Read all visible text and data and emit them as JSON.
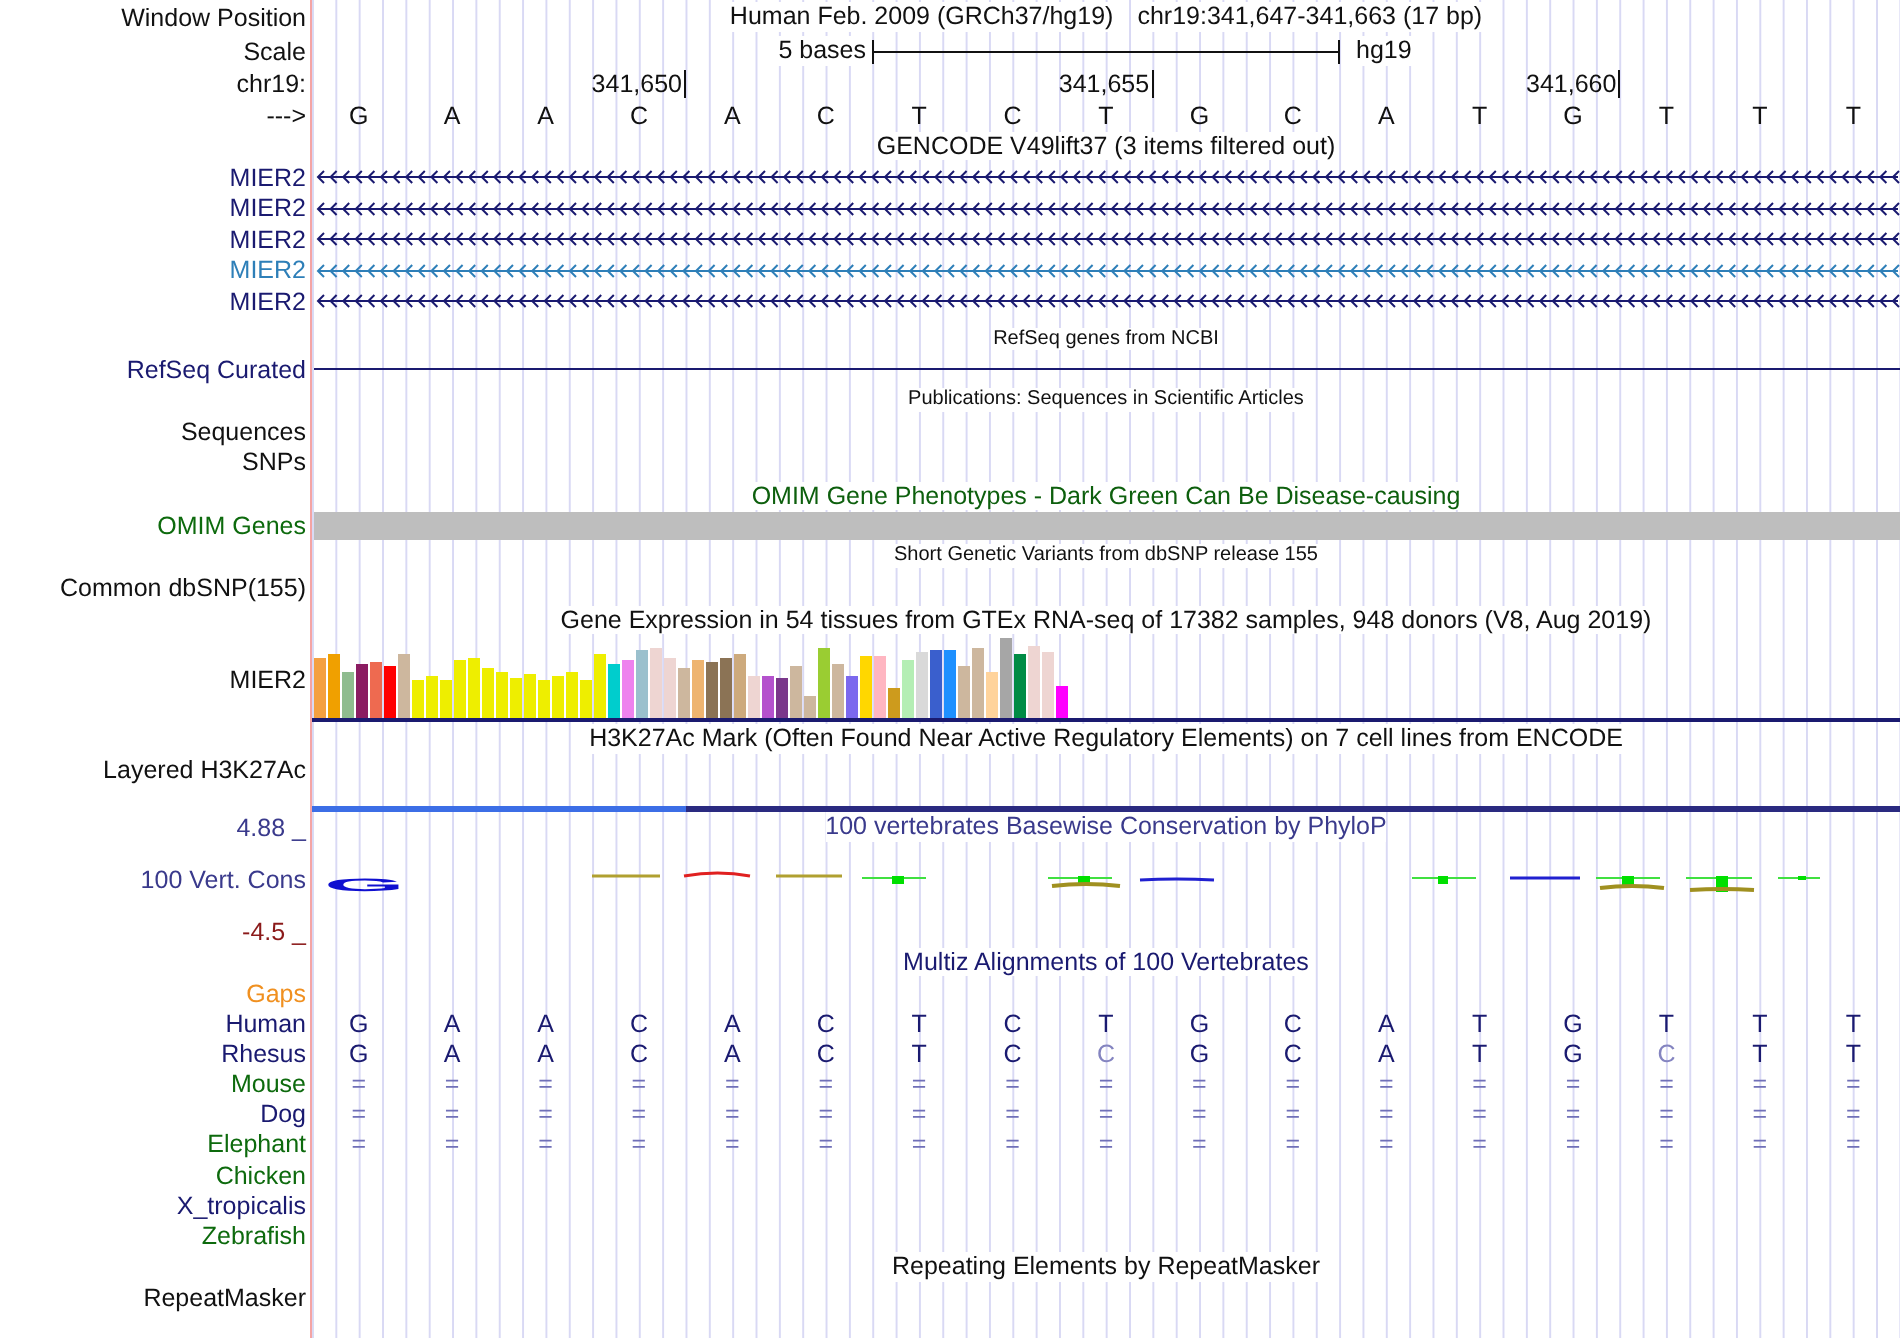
{
  "header": {
    "window_position_label": "Window Position",
    "assembly": "Human Feb. 2009 (GRCh37/hg19)",
    "position": "chr19:341,647-341,663 (17 bp)",
    "scale_label": "Scale",
    "scale_text": "5 bases",
    "scale_db": "hg19",
    "chrom_label": "chr19:",
    "strand_label": "--->"
  },
  "bases": [
    {
      "letter": "G"
    },
    {
      "letter": "A"
    },
    {
      "letter": "A"
    },
    {
      "letter": "C",
      "tick": "341,650"
    },
    {
      "letter": "A"
    },
    {
      "letter": "C"
    },
    {
      "letter": "T"
    },
    {
      "letter": "C"
    },
    {
      "letter": "T",
      "tick": "341,655"
    },
    {
      "letter": "G"
    },
    {
      "letter": "C"
    },
    {
      "letter": "A"
    },
    {
      "letter": "T"
    },
    {
      "letter": "G",
      "tick": "341,660"
    },
    {
      "letter": "T"
    },
    {
      "letter": "T"
    },
    {
      "letter": "T"
    }
  ],
  "gencode": {
    "title": "GENCODE V49lift37 (3 items filtered out)",
    "genes": [
      {
        "name": "MIER2",
        "color": "#1a1a70"
      },
      {
        "name": "MIER2",
        "color": "#1a1a70"
      },
      {
        "name": "MIER2",
        "color": "#1a1a70"
      },
      {
        "name": "MIER2",
        "color": "#2e7fb8"
      },
      {
        "name": "MIER2",
        "color": "#1a1a70"
      }
    ]
  },
  "refseq": {
    "title": "RefSeq genes from NCBI",
    "label": "RefSeq Curated"
  },
  "publications": {
    "title": "Publications: Sequences in Scientific Articles",
    "labels": [
      "Sequences",
      "SNPs"
    ]
  },
  "omim": {
    "title": "OMIM Gene Phenotypes - Dark Green Can Be Disease-causing",
    "label": "OMIM Genes"
  },
  "dbsnp": {
    "title": "Short Genetic Variants from dbSNP release 155",
    "label": "Common dbSNP(155)"
  },
  "gtex": {
    "title": "Gene Expression in 54 tissues from GTEx RNA-seq of 17382 samples, 948 donors (V8, Aug 2019)",
    "label": "MIER2"
  },
  "h3k27ac": {
    "title": "H3K27Ac Mark (Often Found Near Active Regulatory Elements) on 7 cell lines from ENCODE",
    "label": "Layered H3K27Ac"
  },
  "conservation": {
    "title": "100 vertebrates Basewise Conservation by PhyloP",
    "label": "100 Vert. Cons",
    "max": "4.88 _",
    "min": "-4.5 _",
    "logo_letter": "G"
  },
  "multiz": {
    "title": "Multiz Alignments of 100 Vertebrates",
    "gaps_label": "Gaps",
    "species": [
      {
        "name": "Human",
        "color": "#1a1a70",
        "kind": "bases",
        "bases": [
          {
            "letter": "G",
            "match": true
          },
          {
            "letter": "A",
            "match": true
          },
          {
            "letter": "A",
            "match": true
          },
          {
            "letter": "C",
            "match": true
          },
          {
            "letter": "A",
            "match": true
          },
          {
            "letter": "C",
            "match": true
          },
          {
            "letter": "T",
            "match": true
          },
          {
            "letter": "C",
            "match": true
          },
          {
            "letter": "T",
            "match": true
          },
          {
            "letter": "G",
            "match": true
          },
          {
            "letter": "C",
            "match": true
          },
          {
            "letter": "A",
            "match": true
          },
          {
            "letter": "T",
            "match": true
          },
          {
            "letter": "G",
            "match": true
          },
          {
            "letter": "T",
            "match": true
          },
          {
            "letter": "T",
            "match": true
          },
          {
            "letter": "T",
            "match": true
          }
        ]
      },
      {
        "name": "Rhesus",
        "color": "#1a1a70",
        "kind": "bases",
        "bases": [
          {
            "letter": "G",
            "match": true
          },
          {
            "letter": "A",
            "match": true
          },
          {
            "letter": "A",
            "match": true
          },
          {
            "letter": "C",
            "match": true
          },
          {
            "letter": "A",
            "match": true
          },
          {
            "letter": "C",
            "match": true
          },
          {
            "letter": "T",
            "match": true
          },
          {
            "letter": "C",
            "match": true
          },
          {
            "letter": "C",
            "match": false
          },
          {
            "letter": "G",
            "match": true
          },
          {
            "letter": "C",
            "match": true
          },
          {
            "letter": "A",
            "match": true
          },
          {
            "letter": "T",
            "match": true
          },
          {
            "letter": "G",
            "match": true
          },
          {
            "letter": "C",
            "match": false
          },
          {
            "letter": "T",
            "match": true
          },
          {
            "letter": "T",
            "match": true
          }
        ]
      },
      {
        "name": "Mouse",
        "color": "#0d6a0d",
        "kind": "equals",
        "bases": [
          {
            "letter": "="
          },
          {
            "letter": "="
          },
          {
            "letter": "="
          },
          {
            "letter": "="
          },
          {
            "letter": "="
          },
          {
            "letter": "="
          },
          {
            "letter": "="
          },
          {
            "letter": "="
          },
          {
            "letter": "="
          },
          {
            "letter": "="
          },
          {
            "letter": "="
          },
          {
            "letter": "="
          },
          {
            "letter": "="
          },
          {
            "letter": "="
          },
          {
            "letter": "="
          },
          {
            "letter": "="
          },
          {
            "letter": "="
          }
        ]
      },
      {
        "name": "Dog",
        "color": "#1a1a70",
        "kind": "equals",
        "bases": [
          {
            "letter": "="
          },
          {
            "letter": "="
          },
          {
            "letter": "="
          },
          {
            "letter": "="
          },
          {
            "letter": "="
          },
          {
            "letter": "="
          },
          {
            "letter": "="
          },
          {
            "letter": "="
          },
          {
            "letter": "="
          },
          {
            "letter": "="
          },
          {
            "letter": "="
          },
          {
            "letter": "="
          },
          {
            "letter": "="
          },
          {
            "letter": "="
          },
          {
            "letter": "="
          },
          {
            "letter": "="
          },
          {
            "letter": "="
          }
        ]
      },
      {
        "name": "Elephant",
        "color": "#0d6a0d",
        "kind": "equals",
        "bases": [
          {
            "letter": "="
          },
          {
            "letter": "="
          },
          {
            "letter": "="
          },
          {
            "letter": "="
          },
          {
            "letter": "="
          },
          {
            "letter": "="
          },
          {
            "letter": "="
          },
          {
            "letter": "="
          },
          {
            "letter": "="
          },
          {
            "letter": "="
          },
          {
            "letter": "="
          },
          {
            "letter": "="
          },
          {
            "letter": "="
          },
          {
            "letter": "="
          },
          {
            "letter": "="
          },
          {
            "letter": "="
          },
          {
            "letter": "="
          }
        ]
      },
      {
        "name": "Chicken",
        "color": "#0d6a0d",
        "kind": "none"
      },
      {
        "name": "X_tropicalis",
        "color": "#1a1a70",
        "kind": "none"
      },
      {
        "name": "Zebrafish",
        "color": "#0d6a0d",
        "kind": "none"
      }
    ]
  },
  "repeatmasker": {
    "title": "Repeating Elements by RepeatMasker",
    "label": "RepeatMasker"
  }
}
